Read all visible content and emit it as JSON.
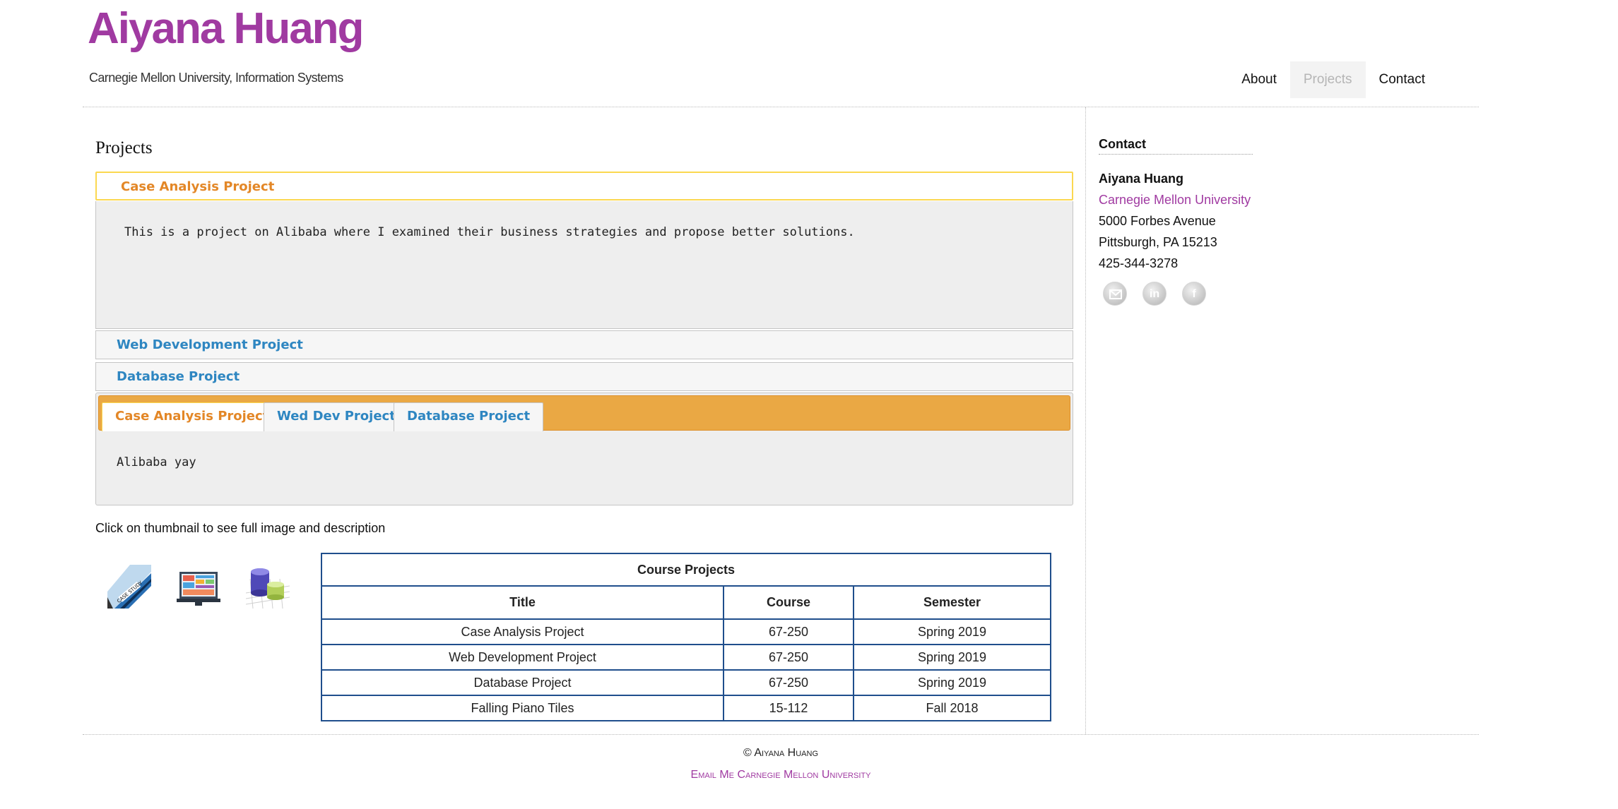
{
  "site": {
    "title": "Aiyana Huang",
    "subtitle": "Carnegie Mellon University, Information Systems"
  },
  "nav": {
    "items": [
      {
        "label": "About",
        "active": false
      },
      {
        "label": "Projects",
        "active": true
      },
      {
        "label": "Contact",
        "active": false
      }
    ]
  },
  "main": {
    "heading": "Projects",
    "accordion": [
      {
        "label": "Case Analysis Project",
        "expanded": true,
        "content": "This is a project on Alibaba where I examined their business strategies and propose better solutions."
      },
      {
        "label": "Web Development Project",
        "expanded": false
      },
      {
        "label": "Database Project",
        "expanded": false
      }
    ],
    "tabs": {
      "items": [
        "Case Analysis Project",
        "Wed Dev Project",
        "Database Project"
      ],
      "active_index": 0,
      "content": "Alibaba yay"
    },
    "thumbnail_caption": "Click on thumbnail to see full image and description",
    "thumbnails": [
      {
        "icon": "case-study-thumbnail-icon"
      },
      {
        "icon": "web-dev-thumbnail-icon"
      },
      {
        "icon": "database-thumbnail-icon"
      }
    ],
    "table": {
      "caption": "Course Projects",
      "headers": [
        "Title",
        "Course",
        "Semester"
      ],
      "rows": [
        [
          "Case Analysis Project",
          "67-250",
          "Spring 2019"
        ],
        [
          "Web Development Project",
          "67-250",
          "Spring 2019"
        ],
        [
          "Database Project",
          "67-250",
          "Spring 2019"
        ],
        [
          "Falling Piano Tiles",
          "15-112",
          "Fall 2018"
        ]
      ]
    }
  },
  "sidebar": {
    "heading": "Contact",
    "name": "Aiyana Huang",
    "university": "Carnegie Mellon University",
    "address1": "5000 Forbes Avenue",
    "address2": "Pittsburgh, PA 15213",
    "phone": "425-344-3278",
    "social": [
      {
        "icon": "email-icon"
      },
      {
        "icon": "linkedin-icon",
        "glyph": "in"
      },
      {
        "icon": "facebook-icon",
        "glyph": "f"
      }
    ]
  },
  "footer": {
    "copyright": "© Aiyana Huang",
    "link_email": "Email Me",
    "link_university": "Carnegie Mellon University"
  },
  "colors": {
    "brand": "#a03aa1",
    "accordion_active": "#e38727",
    "accordion_link": "#2e86c1",
    "tab_bar": "#eaa844",
    "table_border": "#1f4e8c"
  }
}
